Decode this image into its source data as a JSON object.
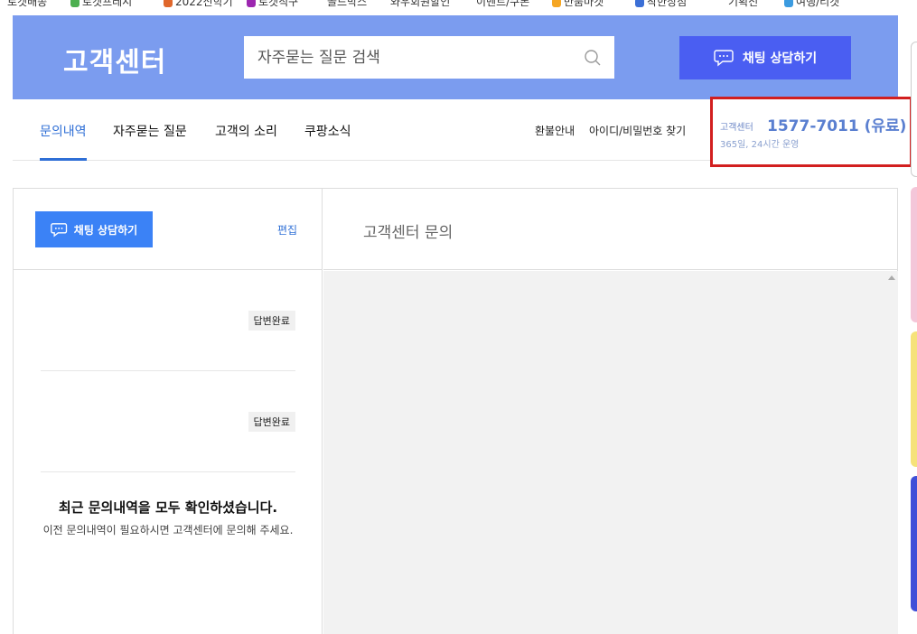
{
  "top_strip": {
    "items": [
      {
        "label": "로켓배송",
        "color": ""
      },
      {
        "label": "로켓프레시",
        "color": "#4caf50"
      },
      {
        "label": "2022신학기",
        "color": "#e0672b"
      },
      {
        "label": "로켓직구",
        "color": "#9c27b0"
      },
      {
        "label": "골드박스",
        "color": ""
      },
      {
        "label": "와우회원할인",
        "color": ""
      },
      {
        "label": "이벤트/쿠폰",
        "color": ""
      },
      {
        "label": "반품마켓",
        "color": "#f5a623"
      },
      {
        "label": "착한상점",
        "color": "#3b6fd6"
      },
      {
        "label": "기획전",
        "color": ""
      },
      {
        "label": "여행/티켓",
        "color": "#3b9be0"
      }
    ]
  },
  "header": {
    "brand": "고객센터",
    "search_placeholder": "자주묻는 질문 검색",
    "chat_button": "채팅 상담하기",
    "background": "#7b9cef"
  },
  "nav": {
    "tabs": [
      {
        "label": "문의내역",
        "active": true
      },
      {
        "label": "자주묻는 질문",
        "active": false
      },
      {
        "label": "고객의 소리",
        "active": false
      },
      {
        "label": "쿠팡소식",
        "active": false
      }
    ],
    "utility": [
      "환불안내",
      "아이디/비밀번호 찾기"
    ],
    "cs": {
      "label": "고객센터",
      "phone": "1577-7011 (유료)",
      "hours": "365일, 24시간 운영"
    }
  },
  "left_panel": {
    "chat_button": "채팅 상담하기",
    "edit": "편집",
    "inquiries": [
      {
        "status": "답변완료"
      },
      {
        "status": "답변완료"
      }
    ],
    "done_title": "최근 문의내역을 모두 확인하셨습니다.",
    "done_sub": "이전 문의내역이 필요하시면 고객센터에 문의해 주세요."
  },
  "right_panel": {
    "title": "고객센터 문의"
  },
  "colors": {
    "primary": "#4a5ef2",
    "accent_blue": "#3b82f6",
    "active_tab": "#2f6fd6",
    "highlight_box": "#d21f1f"
  }
}
